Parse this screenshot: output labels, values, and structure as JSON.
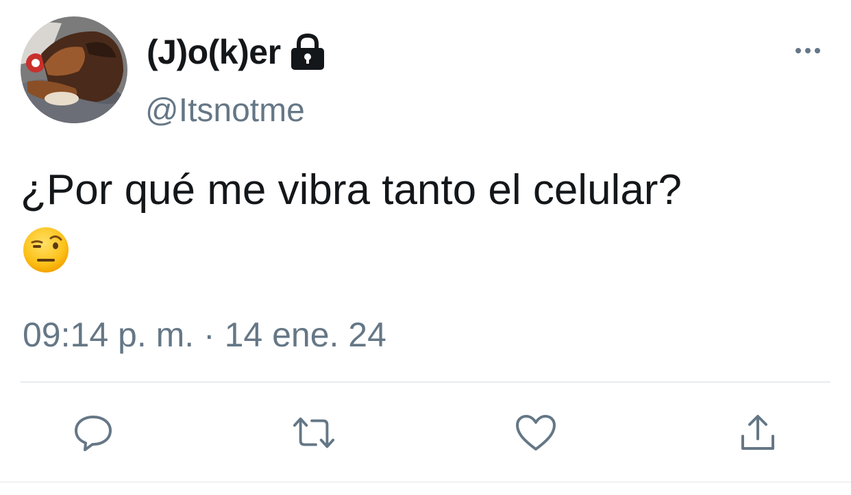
{
  "tweet": {
    "display_name": "(J)o(k)er",
    "handle": "@Itsnotme",
    "text": "¿Por qué me vibra tanto el celular?",
    "emoji": "face-with-raised-eyebrow",
    "timestamp": "09:14 p. m. · 14 ene. 24",
    "protected": true
  },
  "icons": {
    "lock": "lock-icon",
    "more": "more-options-icon",
    "reply": "reply-icon",
    "retweet": "retweet-icon",
    "like": "heart-icon",
    "share": "share-icon"
  },
  "colors": {
    "text_primary": "#14171a",
    "text_secondary": "#657786",
    "divider": "#e6ecf0"
  }
}
